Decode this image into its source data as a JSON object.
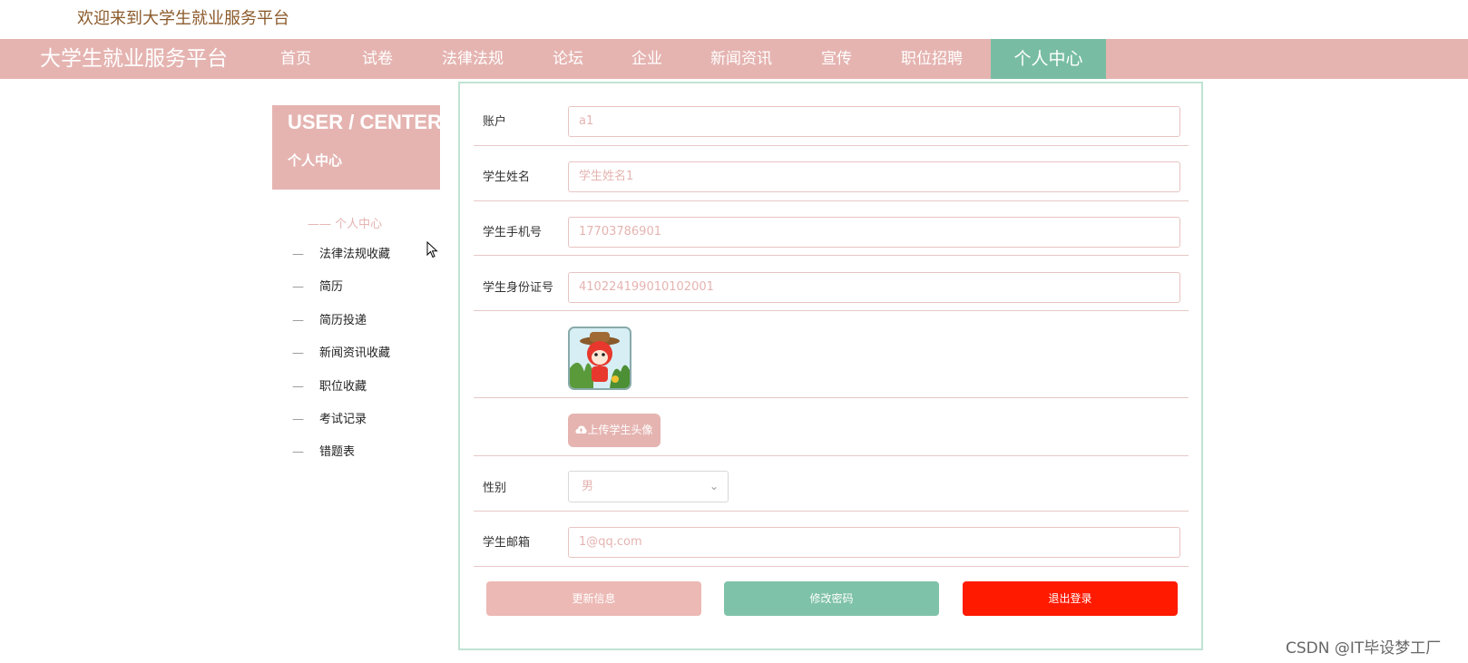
{
  "header": {
    "welcome": "欢迎来到大学生就业服务平台",
    "brand": "大学生就业服务平台"
  },
  "nav": {
    "items": [
      "首页",
      "试卷",
      "法律法规",
      "论坛",
      "企业",
      "新闻资讯",
      "宣传",
      "职位招聘",
      "个人中心"
    ],
    "active": "个人中心"
  },
  "sidebar": {
    "title_en": "USER / CENTER",
    "title_cn": "个人中心",
    "current": "—— 个人中心",
    "items": [
      "法律法规收藏",
      "简历",
      "简历投递",
      "新闻资讯收藏",
      "职位收藏",
      "考试记录",
      "错题表"
    ],
    "dash": "—"
  },
  "form": {
    "account": {
      "label": "账户",
      "value": "a1"
    },
    "name": {
      "label": "学生姓名",
      "value": "学生姓名1"
    },
    "phone": {
      "label": "学生手机号",
      "value": "17703786901"
    },
    "idcard": {
      "label": "学生身份证号",
      "value": "410224199010102001"
    },
    "upload_label": "上传学生头像",
    "gender": {
      "label": "性别",
      "value": "男"
    },
    "email": {
      "label": "学生邮箱",
      "value": "1@qq.com"
    }
  },
  "buttons": {
    "update": "更新信息",
    "change_password": "修改密码",
    "logout": "退出登录"
  },
  "watermark": "CSDN @IT毕设梦工厂",
  "colors": {
    "accent_pink": "#e5b4b1",
    "accent_green": "#78bda3",
    "danger_red": "#ff1a00",
    "welcome_brown": "#8b5a2b"
  }
}
